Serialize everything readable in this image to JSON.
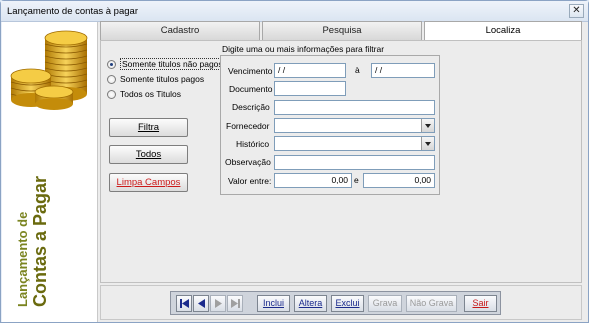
{
  "window": {
    "title": "Lançamento de contas à pagar",
    "close_symbol": "✕"
  },
  "sidebar": {
    "caption_small": "Lançamento de",
    "caption_big": "Contas a Pagar",
    "coin_color": "#d8a017"
  },
  "tabs": [
    {
      "label": "Cadastro",
      "active": false
    },
    {
      "label": "Pesquisa",
      "active": false
    },
    {
      "label": "Localiza",
      "active": true
    }
  ],
  "filter": {
    "hint": "Digite uma ou mais informações para filtrar",
    "radios": [
      {
        "label": "Somente titulos não pagos",
        "checked": true
      },
      {
        "label": "Somente titulos pagos",
        "checked": false
      },
      {
        "label": "Todos os Titulos",
        "checked": false
      }
    ],
    "buttons": {
      "filtra": "Filtra",
      "todos": "Todos",
      "limpa": "Limpa Campos"
    }
  },
  "form": {
    "vencimento_label": "Vencimento",
    "vencimento_de": "/ /",
    "a_label": "à",
    "vencimento_ate": "/ /",
    "documento_label": "Documento",
    "documento_value": "",
    "descricao_label": "Descrição",
    "descricao_value": "",
    "fornecedor_label": "Fornecedor",
    "fornecedor_value": "",
    "historico_label": "Histórico",
    "historico_value": "",
    "observacao_label": "Observação",
    "observacao_value": "",
    "valor_label": "Valor entre:",
    "valor_de": "0,00",
    "e_label": "e",
    "valor_ate": "0,00"
  },
  "navigator": {
    "inclui": "Inclui",
    "altera": "Altera",
    "exclui": "Exclui",
    "grava": "Grava",
    "nao_grava": "Não Grava",
    "sair": "Sair"
  },
  "colors": {
    "accent_blue": "#1a2a8c",
    "danger_red": "#c81818",
    "caption_olive": "#6a6a0e"
  }
}
